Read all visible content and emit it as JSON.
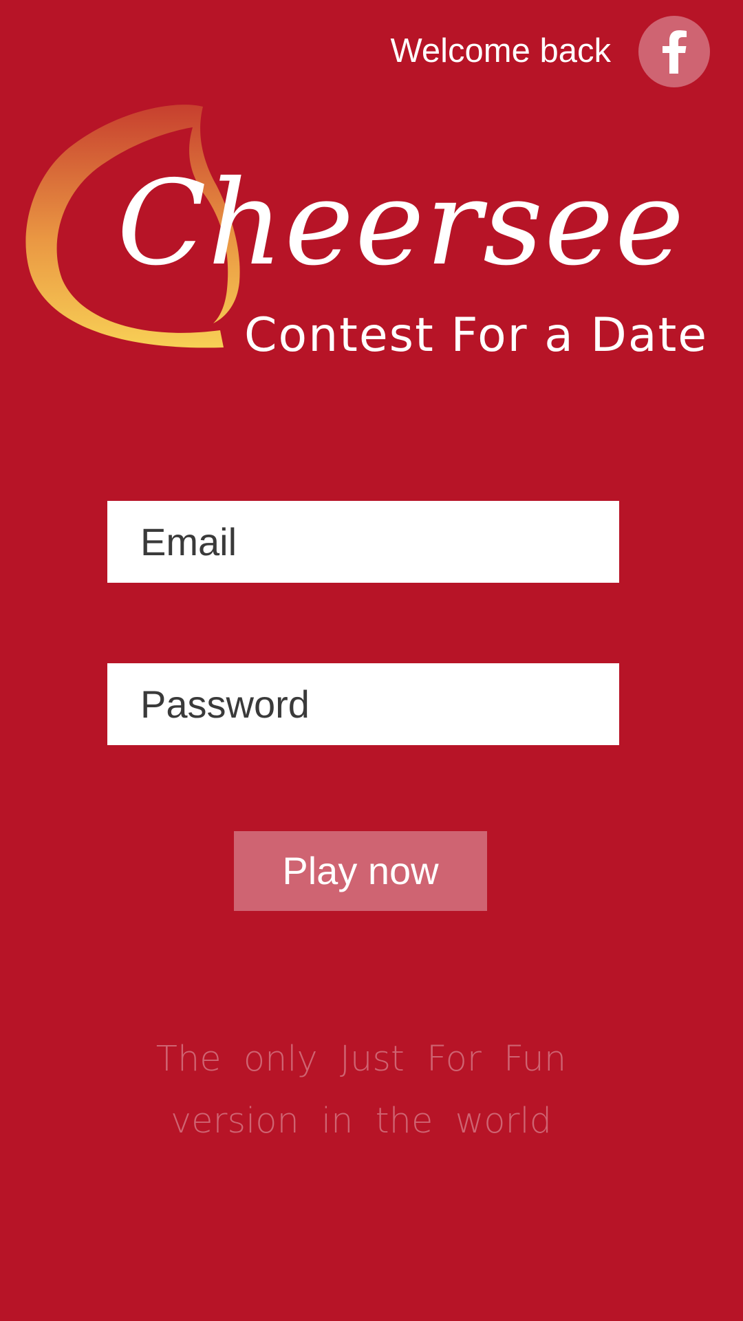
{
  "header": {
    "welcome_text": "Welcome back",
    "facebook_icon": "facebook-f-icon"
  },
  "logo": {
    "wordmark": "Cheersee",
    "tagline": "Contest For a Date",
    "swoosh_icon": "flame-swoosh-icon"
  },
  "form": {
    "email_placeholder": "Email",
    "password_placeholder": "Password",
    "submit_label": "Play now"
  },
  "footer": {
    "line1": "The only Just For Fun",
    "line2": "version in the world"
  },
  "colors": {
    "background": "#b71427",
    "accent": "#cf6472",
    "field_background": "#ffffff",
    "field_text": "#3a3a3a",
    "swoosh_gradient_top": "#c8432f",
    "swoosh_gradient_bottom": "#fde05a"
  }
}
